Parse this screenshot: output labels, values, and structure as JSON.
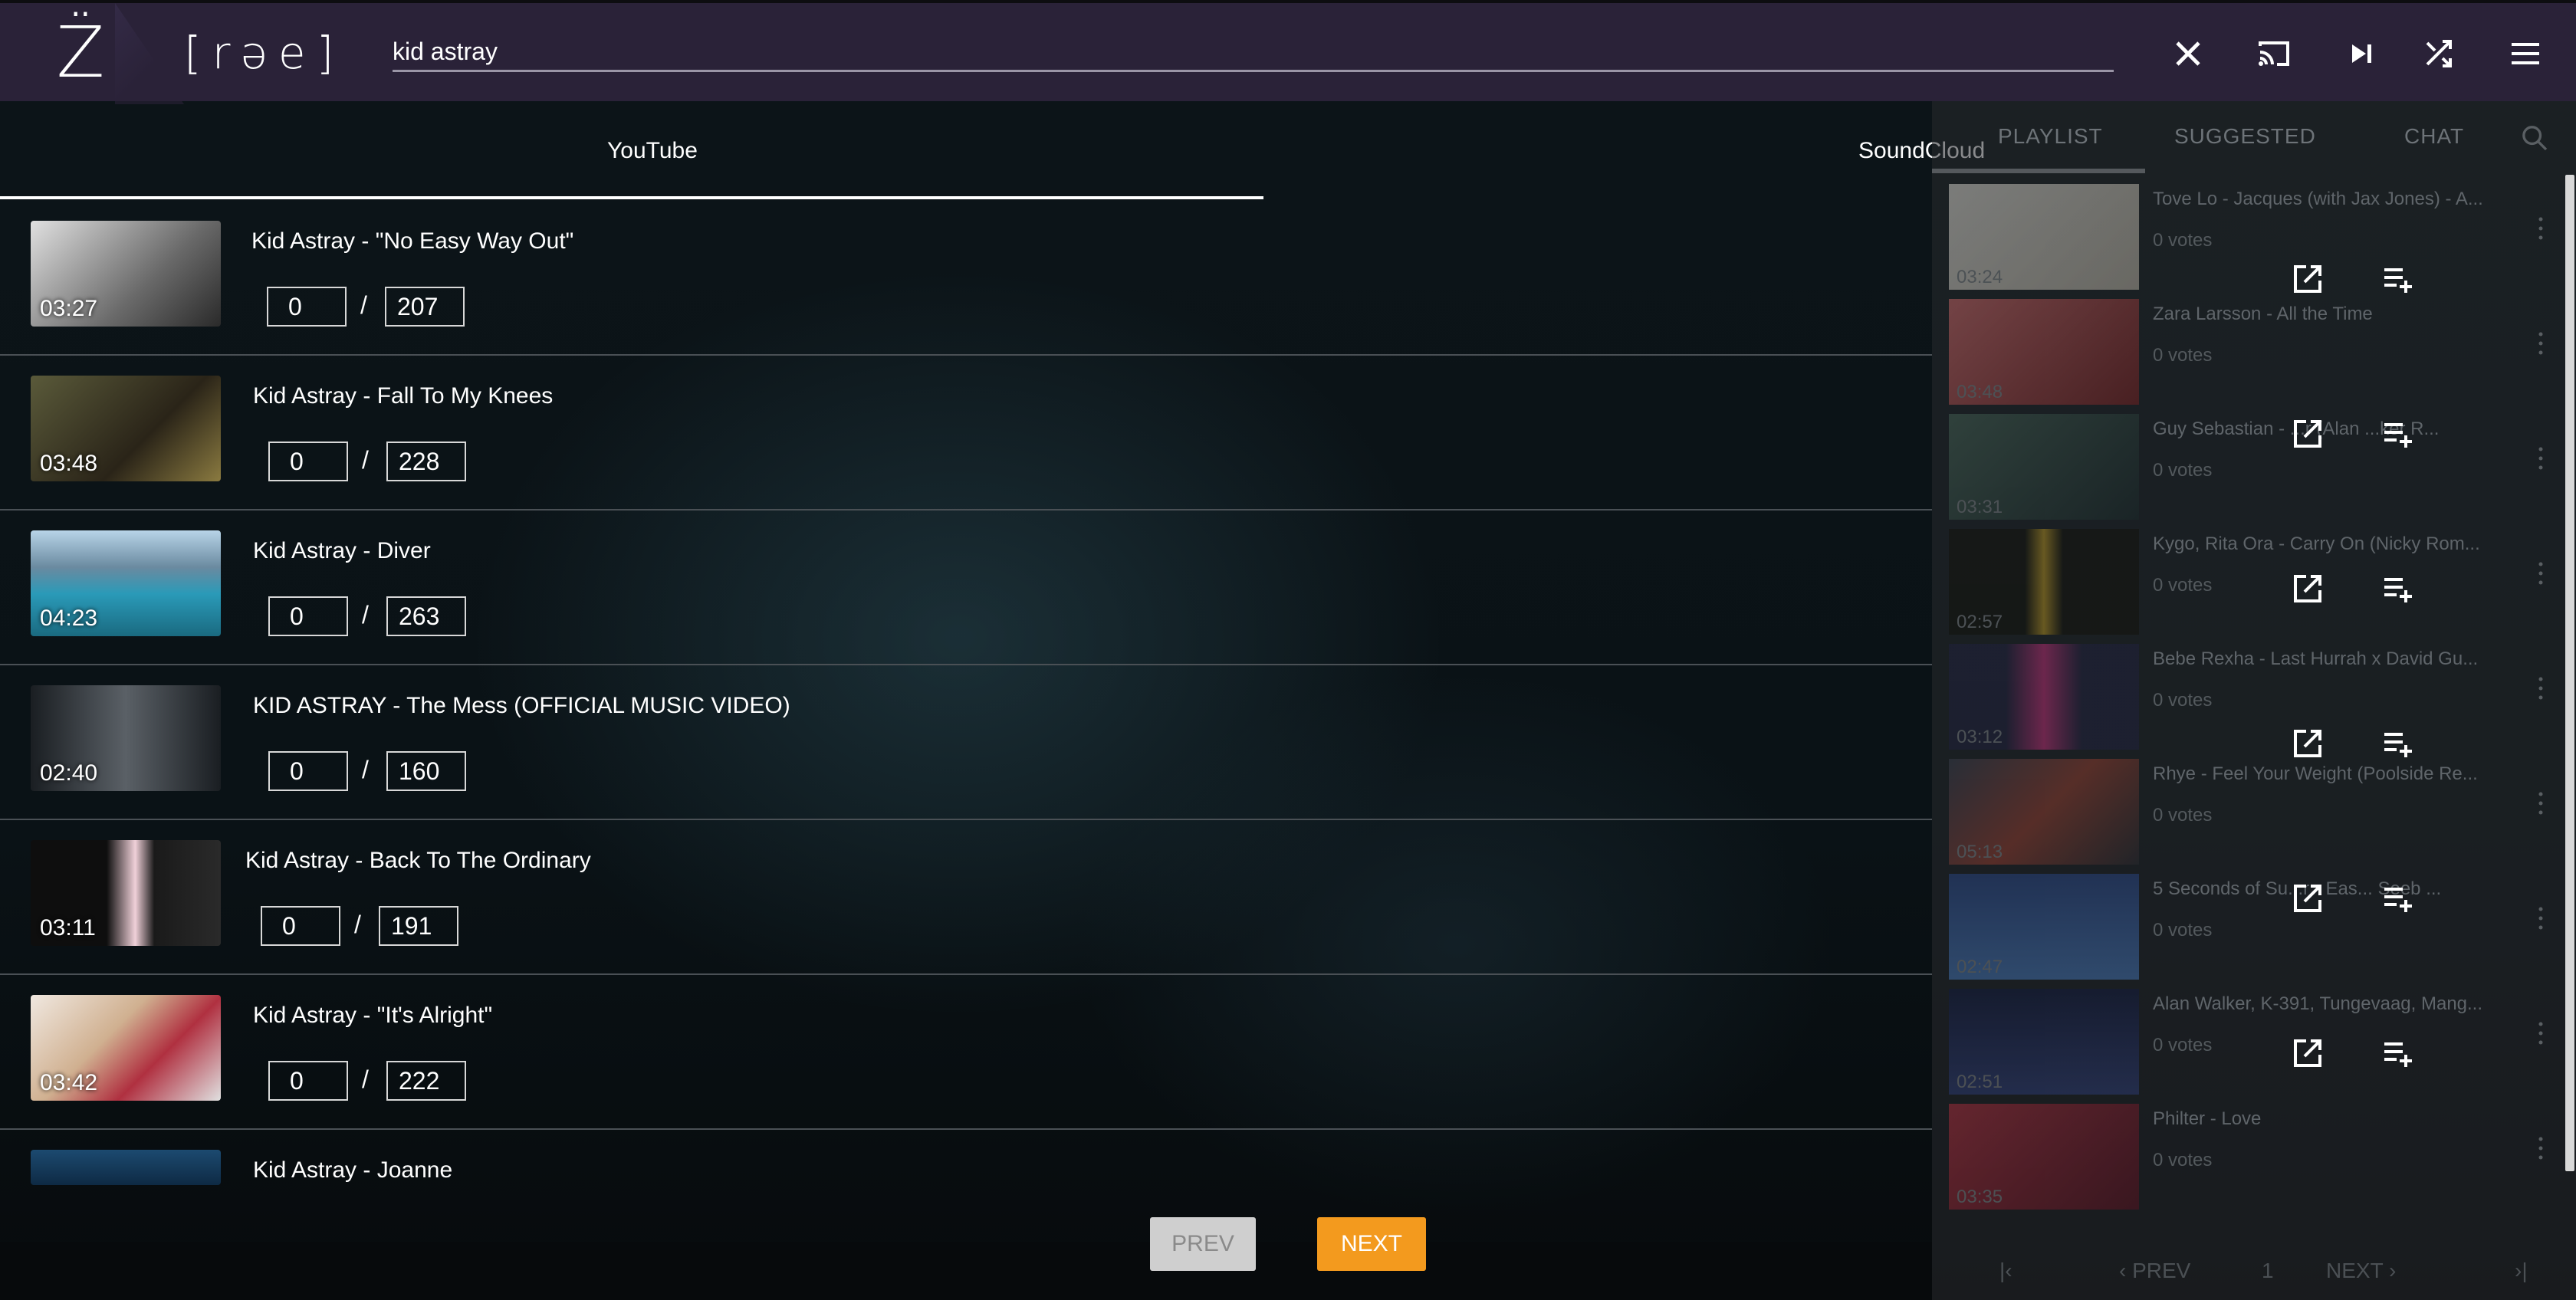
{
  "header": {
    "logo_mark": "Z̈",
    "logo_text": "[rəe]",
    "search_value": "kid astray"
  },
  "source_tabs": [
    {
      "label": "YouTube"
    },
    {
      "label": "SoundCloud"
    }
  ],
  "results": [
    {
      "title": "Kid Astray - \"No Easy Way Out\"",
      "duration": "03:27",
      "votes": "0",
      "total": "207",
      "thumb_color": "#c9c9c9"
    },
    {
      "title": "Kid Astray - Fall To My Knees",
      "duration": "03:48",
      "votes": "0",
      "total": "228",
      "thumb_color": "#3a3a2a"
    },
    {
      "title": "Kid Astray - Diver",
      "duration": "04:23",
      "votes": "0",
      "total": "263",
      "thumb_color": "#4aa8c8"
    },
    {
      "title": "KID ASTRAY - The Mess (OFFICIAL MUSIC VIDEO)",
      "duration": "02:40",
      "votes": "0",
      "total": "160",
      "thumb_color": "#3c4246"
    },
    {
      "title": "Kid Astray - Back To The Ordinary",
      "duration": "03:11",
      "votes": "0",
      "total": "191",
      "thumb_color": "#1a1a1a"
    },
    {
      "title": "Kid Astray - \"It's Alright\"",
      "duration": "03:42",
      "votes": "0",
      "total": "222",
      "thumb_color": "#d8c8b8"
    },
    {
      "title": "Kid Astray - Joanne",
      "duration": "",
      "votes": "",
      "total": "",
      "thumb_color": "#1c4a70"
    }
  ],
  "pagination": {
    "prev": "PREV",
    "next": "NEXT"
  },
  "right_panel": {
    "tabs": [
      "PLAYLIST",
      "SUGGESTED",
      "CHAT"
    ],
    "items": [
      {
        "title": "Tove Lo - Jacques (with Jax Jones) - A...",
        "votes": "0  votes",
        "duration": "03:24",
        "thumb_color": "#e8e2d8"
      },
      {
        "title": "Zara Larsson - All the Time",
        "votes": "0  votes",
        "duration": "03:48",
        "thumb_color": "#c45050"
      },
      {
        "title": "Guy Sebastian - ...r (Alan ...ker R...",
        "votes": "0  votes",
        "duration": "03:31",
        "thumb_color": "#2a3a3a"
      },
      {
        "title": "Kygo, Rita Ora - Carry On (Nicky Rom...",
        "votes": "0  votes",
        "duration": "02:57",
        "thumb_color": "#1a1a10"
      },
      {
        "title": "Bebe Rexha - Last Hurrah x David Gu...",
        "votes": "0  votes",
        "duration": "03:12",
        "thumb_color": "#b03060"
      },
      {
        "title": "Rhye - Feel Your Weight (Poolside Re...",
        "votes": "0  votes",
        "duration": "05:13",
        "thumb_color": "#7a3020"
      },
      {
        "title": "5 Seconds of Su...r - Eas... Seeb ...",
        "votes": "0  votes",
        "duration": "02:47",
        "thumb_color": "#3060a0"
      },
      {
        "title": "Alan Walker, K-391, Tungevaag, Mang...",
        "votes": "0  votes",
        "duration": "02:51",
        "thumb_color": "#203060"
      },
      {
        "title": "Philter - Love",
        "votes": "0  votes",
        "duration": "03:35",
        "thumb_color": "#8a2030"
      }
    ],
    "pager": {
      "prev": "PREV",
      "page": "1",
      "next": "NEXT"
    }
  },
  "colors": {
    "topbar": "#2a2238",
    "accent": "#f39a1e",
    "tab_underline": "#ffffff"
  }
}
